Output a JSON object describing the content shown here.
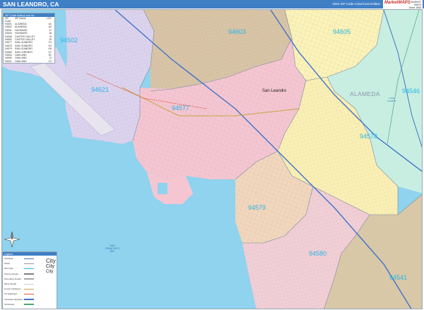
{
  "header": {
    "title": "SAN LEANDRO, CA",
    "edition": "2022 ZIP Code Color/Cast Edition",
    "brand": "MarketMAPS",
    "brand_side": [
      "MARKET",
      "MAPS",
      "Since 1965"
    ]
  },
  "colors": {
    "header_bar": "#3f7fc6",
    "water": "#8fd3ee",
    "zip_label": "#27b6e6",
    "zip_94577": "#f5c6d2",
    "zip_94579": "#f2d7bd",
    "zip_94603": "#d9c4a6",
    "zip_94605": "#fbf3b8",
    "zip_94621": "#dcd3ef",
    "zip_94578": "#fbf0b4",
    "zip_94546": "#c8eee2",
    "zip_94541": "#d8c8a8",
    "zip_94580": "#f2cfd6"
  },
  "zip_labels": {
    "z94502": "94502",
    "z94603": "94603",
    "z94605": "94605",
    "z94621": "94621",
    "z94577": "94577",
    "z94546": "94546",
    "z94578": "94578",
    "z94579": "94579",
    "z94580": "94580",
    "z94541": "94541"
  },
  "places": {
    "san_leandro": "San Leandro",
    "alameda_county": "ALAMEDA",
    "bay": [
      "SAN",
      "FRANCISCO",
      "BAY"
    ],
    "lake": [
      "LAKE",
      "CHABOT"
    ]
  },
  "zip_index": {
    "heading": "ZIP Code Index/Look Up",
    "columns": [
      "ZIP Code",
      "ZIP Name",
      "LOC"
    ],
    "rows": [
      [
        "94501",
        "ALAMEDA",
        "A1"
      ],
      [
        "94502",
        "ALAMEDA",
        "A2"
      ],
      [
        "94541",
        "HAYWARD",
        "J7"
      ],
      [
        "94544",
        "HAYWARD",
        "J8"
      ],
      [
        "94546",
        "CASTRO VALLEY",
        "I5"
      ],
      [
        "94552",
        "CASTRO VALLEY",
        "J5"
      ],
      [
        "94577",
        "SAN LEANDRO",
        "F4"
      ],
      [
        "94578",
        "SAN LEANDRO",
        "H4"
      ],
      [
        "94579",
        "SAN LEANDRO",
        "G6"
      ],
      [
        "94580",
        "SAN LORENZO",
        "H7"
      ],
      [
        "94603",
        "OAKLAND",
        "E2"
      ],
      [
        "94605",
        "OAKLAND",
        "I2"
      ],
      [
        "94621",
        "OAKLAND",
        "C3"
      ]
    ]
  },
  "legend": {
    "heading": "Legend",
    "rows": [
      "Interstate",
      "Street",
      "ZIP Code",
      "Primary Roads",
      "Secondary Roads",
      "Minor Roads",
      "County Highways",
      "US Highways",
      "Interstate Highways",
      "Toll Roads"
    ],
    "city_labels": [
      "City",
      "City",
      "City"
    ]
  }
}
